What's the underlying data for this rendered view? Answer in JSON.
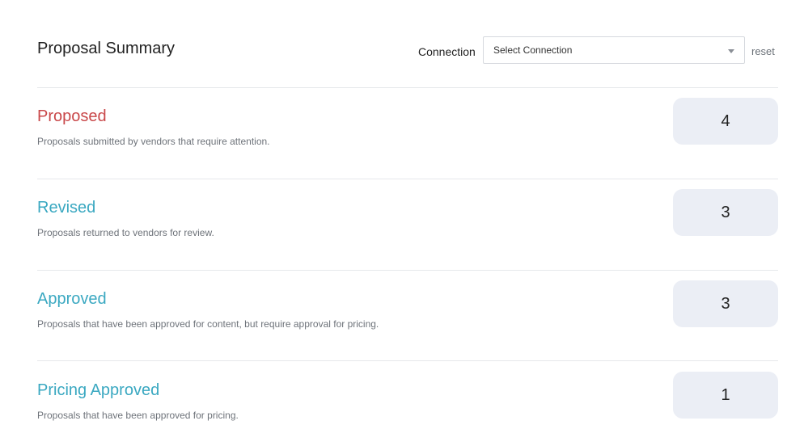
{
  "header": {
    "title": "Proposal Summary",
    "connection_label": "Connection",
    "connection_select": {
      "selected": "Select Connection"
    },
    "reset_label": "reset"
  },
  "colors": {
    "proposed": "#c9484a",
    "accent": "#3aa8c1"
  },
  "rows": [
    {
      "title": "Proposed",
      "description": "Proposals submitted by vendors that require attention.",
      "count": "4"
    },
    {
      "title": "Revised",
      "description": "Proposals returned to vendors for review.",
      "count": "3"
    },
    {
      "title": "Approved",
      "description": "Proposals that have been approved for content, but require approval for pricing.",
      "count": "3"
    },
    {
      "title": "Pricing Approved",
      "description": "Proposals that have been approved for pricing.",
      "count": "1"
    }
  ]
}
